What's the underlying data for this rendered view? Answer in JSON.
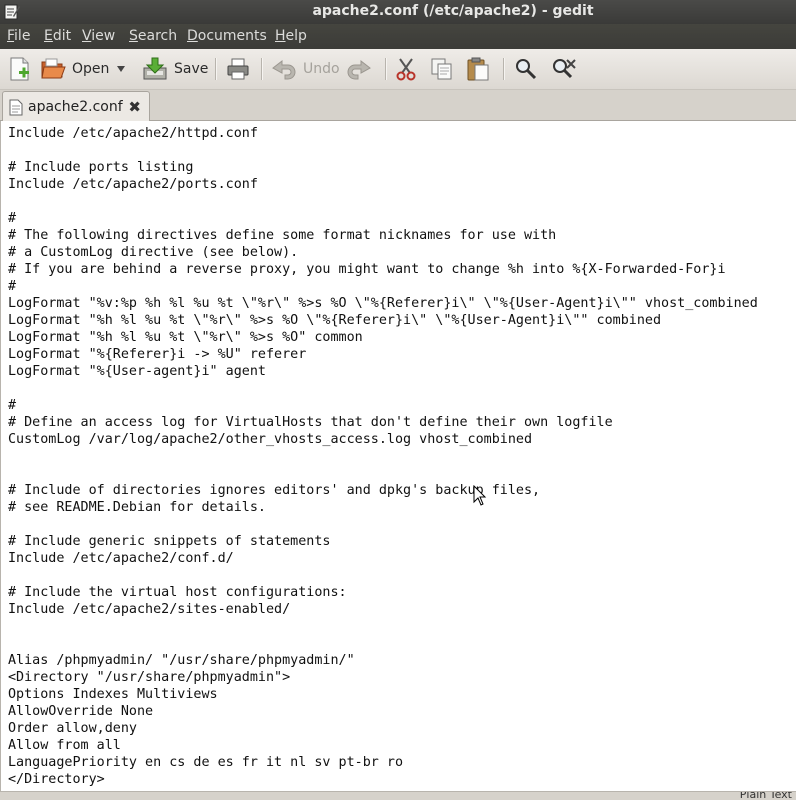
{
  "window": {
    "title": "apache2.conf (/etc/apache2) - gedit"
  },
  "menu": [
    {
      "pre": "",
      "mn": "F",
      "post": "ile"
    },
    {
      "pre": "",
      "mn": "E",
      "post": "dit"
    },
    {
      "pre": "",
      "mn": "V",
      "post": "iew"
    },
    {
      "pre": "",
      "mn": "S",
      "post": "earch"
    },
    {
      "pre": "",
      "mn": "D",
      "post": "ocuments"
    },
    {
      "pre": "",
      "mn": "H",
      "post": "elp"
    }
  ],
  "toolbar": {
    "open_label": "Open",
    "save_label": "Save",
    "undo_label": "Undo"
  },
  "tab": {
    "name": "apache2.conf",
    "close": "✖"
  },
  "editor": {
    "lines": [
      "Include /etc/apache2/httpd.conf",
      "",
      "# Include ports listing",
      "Include /etc/apache2/ports.conf",
      "",
      "#",
      "# The following directives define some format nicknames for use with",
      "# a CustomLog directive (see below).",
      "# If you are behind a reverse proxy, you might want to change %h into %{X-Forwarded-For}i",
      "#",
      "LogFormat \"%v:%p %h %l %u %t \\\"%r\\\" %>s %O \\\"%{Referer}i\\\" \\\"%{User-Agent}i\\\"\" vhost_combined",
      "LogFormat \"%h %l %u %t \\\"%r\\\" %>s %O \\\"%{Referer}i\\\" \\\"%{User-Agent}i\\\"\" combined",
      "LogFormat \"%h %l %u %t \\\"%r\\\" %>s %O\" common",
      "LogFormat \"%{Referer}i -> %U\" referer",
      "LogFormat \"%{User-agent}i\" agent",
      "",
      "#",
      "# Define an access log for VirtualHosts that don't define their own logfile",
      "CustomLog /var/log/apache2/other_vhosts_access.log vhost_combined",
      "",
      "",
      "# Include of directories ignores editors' and dpkg's backup files,",
      "# see README.Debian for details.",
      "",
      "# Include generic snippets of statements",
      "Include /etc/apache2/conf.d/",
      "",
      "# Include the virtual host configurations:",
      "Include /etc/apache2/sites-enabled/",
      "",
      "",
      "Alias /phpmyadmin/ \"/usr/share/phpmyadmin/\"",
      "<Directory \"/usr/share/phpmyadmin\">",
      "Options Indexes Multiviews",
      "AllowOverride None",
      "Order allow,deny",
      "Allow from all",
      "LanguagePriority en cs de es fr it nl sv pt-br ro",
      "</Directory>"
    ]
  },
  "statusbar": {
    "text": "Plain Text"
  }
}
